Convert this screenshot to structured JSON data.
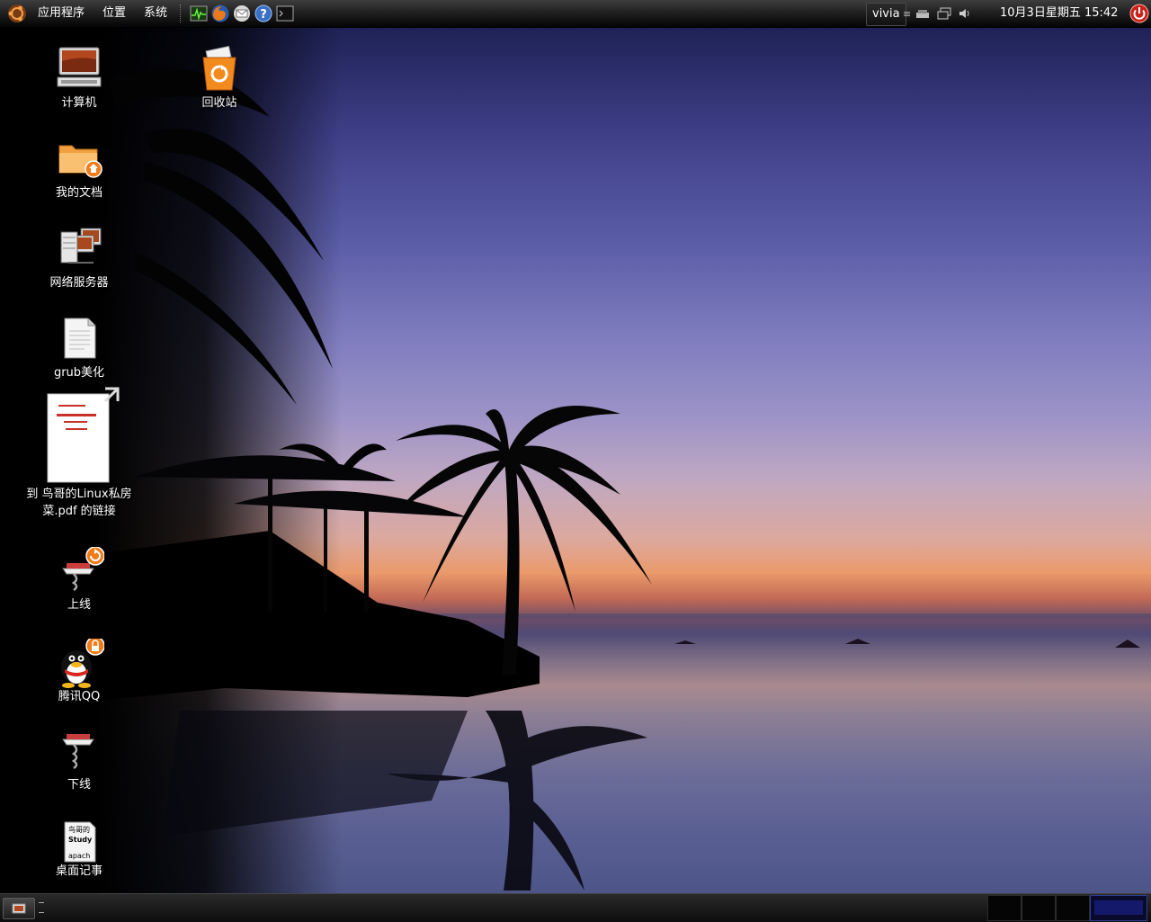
{
  "top_panel": {
    "menus": [
      {
        "label": "应用程序"
      },
      {
        "label": "位置"
      },
      {
        "label": "系统"
      }
    ],
    "user": "vivia",
    "clock": "10月3日星期五  15:42"
  },
  "desktop_icons": [
    {
      "label": "计算机",
      "icon": "computer-icon"
    },
    {
      "label": "回收站",
      "icon": "trash-icon"
    },
    {
      "label": "我的文档",
      "icon": "home-folder-icon"
    },
    {
      "label": "网络服务器",
      "icon": "network-server-icon"
    },
    {
      "label": "grub美化",
      "icon": "text-document-icon"
    },
    {
      "label": "到 鸟哥的Linux私房菜.pdf 的链接",
      "icon": "pdf-link-icon"
    },
    {
      "label": "上线",
      "icon": "connect-icon"
    },
    {
      "label": "腾讯QQ",
      "icon": "qq-penguin-icon"
    },
    {
      "label": "下线",
      "icon": "disconnect-icon"
    },
    {
      "label": "桌面记事",
      "icon": "note-document-icon",
      "preview_text": [
        "鸟哥的",
        "Study",
        "apach"
      ]
    }
  ],
  "colors": {
    "panel": "#1b1b1b",
    "badge_orange": "#f07d1c",
    "sky_top": "#1e2255",
    "horizon": "#ea9a6b"
  }
}
